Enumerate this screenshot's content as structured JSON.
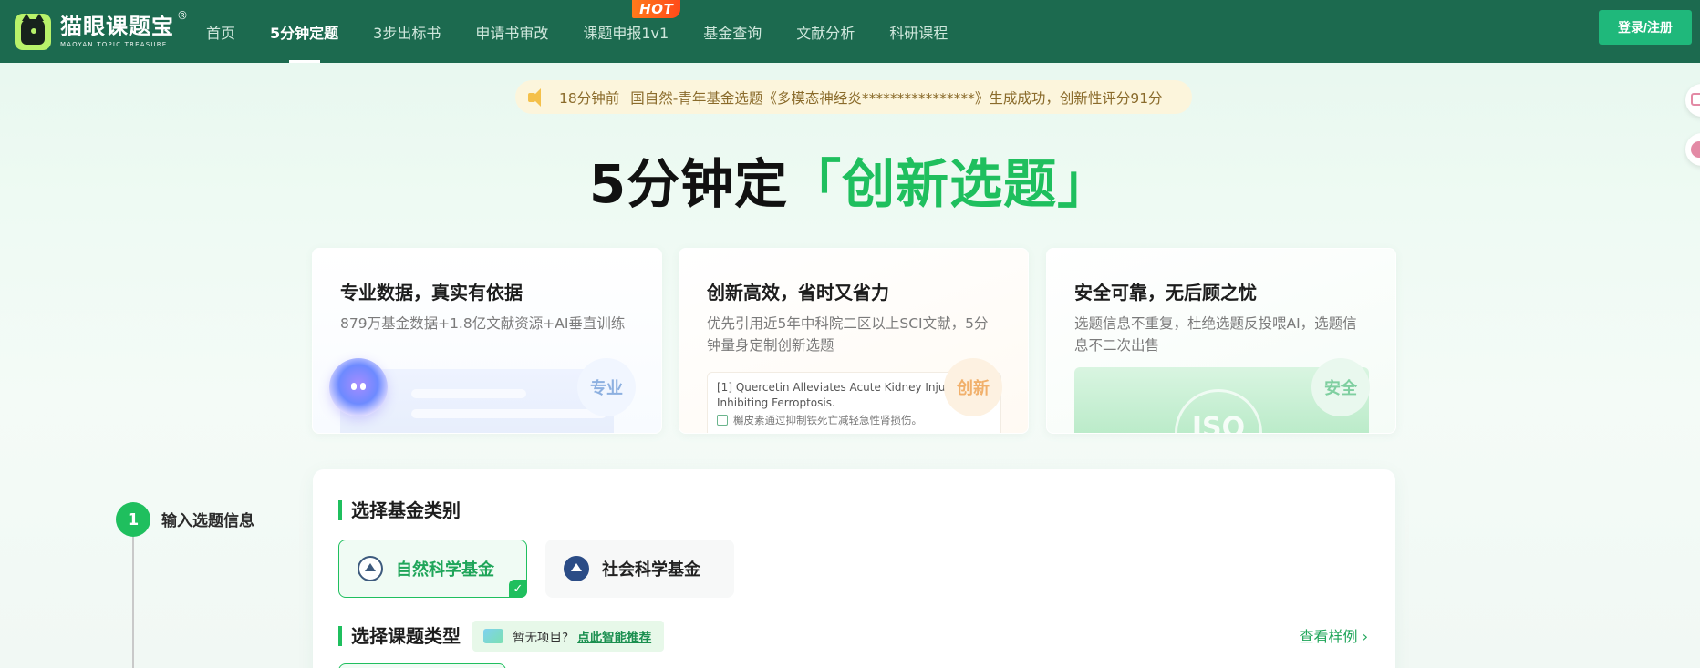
{
  "nav": {
    "logo_title": "猫眼课题宝",
    "logo_registered": "®",
    "logo_subtitle": "MAOYAN TOPIC TREASURE",
    "items": [
      {
        "label": "首页"
      },
      {
        "label": "5分钟定题"
      },
      {
        "label": "3步出标书"
      },
      {
        "label": "申请书审改"
      },
      {
        "label": "课题申报1v1"
      },
      {
        "label": "基金查询"
      },
      {
        "label": "文献分析"
      },
      {
        "label": "科研课程"
      }
    ],
    "active_index": 1,
    "hot_badge": "HOT",
    "login_label": "登录/注册",
    "accent_color": "#1c6a4f"
  },
  "notice": {
    "time": "18分钟前",
    "message": "国自然-青年基金选题《多模态神经炎****************》生成成功，创新性评分91分"
  },
  "hero": {
    "prefix": "5分钟定",
    "highlight": "「创新选题」",
    "highlight_color": "#1fbf5e"
  },
  "features": [
    {
      "title": "专业数据，真实有依据",
      "desc": "879万基金数据+1.8亿文献资源+AI垂直训练",
      "badge": "专业"
    },
    {
      "title": "创新高效，省时又省力",
      "desc": "优先引用近5年中科院二区以上SCI文献，5分钟量身定制创新选题",
      "badge": "创新",
      "sample_en": "[1] Quercetin Alleviates Acute Kidney Injury By Inhibiting Ferroptosis.",
      "sample_cn": "槲皮素通过抑制铁死亡减轻急性肾损伤。"
    },
    {
      "title": "安全可靠，无后顾之忧",
      "desc": "选题信息不重复，杜绝选题反投喂AI，选题信息不二次出售",
      "badge": "安全",
      "seal_text": "ISO"
    }
  ],
  "step": {
    "number": "1",
    "label": "输入选题信息"
  },
  "form": {
    "fund_section_title": "选择基金类别",
    "fund_options": [
      {
        "label": "自然科学基金",
        "selected": true
      },
      {
        "label": "社会科学基金",
        "selected": false
      }
    ],
    "check_mark": "✓",
    "type_section_title": "选择课题类型",
    "no_project_text": "暂无项目?",
    "recommend_link": "点此智能推荐",
    "view_sample": "查看样例",
    "view_sample_chevron": "›"
  }
}
